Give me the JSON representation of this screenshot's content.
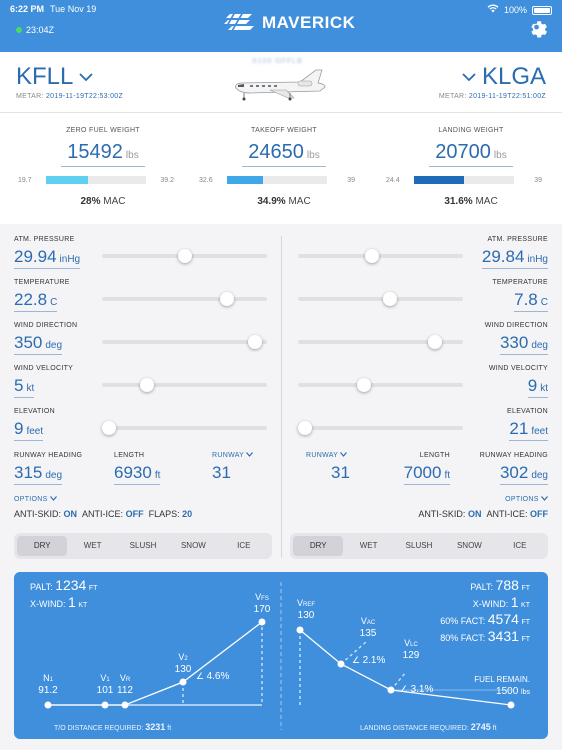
{
  "status": {
    "time": "6:22 PM",
    "day": "Tue Nov 19",
    "battery": "100%",
    "zulu": "23:04Z"
  },
  "brand": {
    "name": "MAVERICK"
  },
  "departure": {
    "code": "KFLL",
    "metar_label": "METAR:",
    "metar_time": "2019-11-19T22:53:00Z"
  },
  "arrival": {
    "code": "KLGA",
    "metar_label": "METAR:",
    "metar_time": "2019-11-19T22:51:00Z"
  },
  "aircraft": {
    "tail": "S100 OFFLB"
  },
  "weights": [
    {
      "title": "ZERO FUEL WEIGHT",
      "value": "15492",
      "unit": "lbs",
      "mac_min": "19.7",
      "mac_max": "39.2",
      "mac_pct": "28%",
      "mac_label": "MAC",
      "fill": 0.42,
      "color": "#5fd0ef"
    },
    {
      "title": "TAKEOFF WEIGHT",
      "value": "24650",
      "unit": "lbs",
      "mac_min": "32.6",
      "mac_max": "39",
      "mac_pct": "34.9%",
      "mac_label": "MAC",
      "fill": 0.36,
      "color": "#3fa9e8"
    },
    {
      "title": "LANDING WEIGHT",
      "value": "20700",
      "unit": "lbs",
      "mac_min": "24.4",
      "mac_max": "39",
      "mac_pct": "31.6%",
      "mac_label": "MAC",
      "fill": 0.5,
      "color": "#1e6bb8"
    }
  ],
  "left_params": [
    {
      "label": "ATM. PRESSURE",
      "value": "29.94",
      "unit": "inHg",
      "level": 0.5
    },
    {
      "label": "TEMPERATURE",
      "value": "22.8",
      "unit": "C",
      "level": 0.76
    },
    {
      "label": "WIND DIRECTION",
      "value": "350",
      "unit": "deg",
      "level": 0.93
    },
    {
      "label": "WIND VELOCITY",
      "value": "5",
      "unit": "kt",
      "level": 0.27
    },
    {
      "label": "ELEVATION",
      "value": "9",
      "unit": "feet",
      "level": 0.04
    }
  ],
  "right_params": [
    {
      "label": "ATM. PRESSURE",
      "value": "29.84",
      "unit": "inHg",
      "level": 0.45
    },
    {
      "label": "TEMPERATURE",
      "value": "7.8",
      "unit": "C",
      "level": 0.56
    },
    {
      "label": "WIND DIRECTION",
      "value": "330",
      "unit": "deg",
      "level": 0.83
    },
    {
      "label": "WIND VELOCITY",
      "value": "9",
      "unit": "kt",
      "level": 0.4
    },
    {
      "label": "ELEVATION",
      "value": "21",
      "unit": "feet",
      "level": 0.04
    }
  ],
  "left_runway": {
    "heading_label": "RUNWAY HEADING",
    "heading": "315",
    "heading_unit": "deg",
    "length_label": "LENGTH",
    "length": "6930",
    "length_unit": "ft",
    "runway_label": "RUNWAY",
    "runway": "31",
    "options_label": "OPTIONS",
    "antiskid_label": "ANTI-SKID:",
    "antiskid": "ON",
    "antiice_label": "ANTI-ICE:",
    "antiice": "OFF",
    "flaps_label": "FLAPS:",
    "flaps": "20"
  },
  "right_runway": {
    "runway_label": "RUNWAY",
    "runway": "31",
    "length_label": "LENGTH",
    "length": "7000",
    "length_unit": "ft",
    "heading_label": "RUNWAY HEADING",
    "heading": "302",
    "heading_unit": "deg",
    "options_label": "OPTIONS",
    "antiskid_label": "ANTI-SKID:",
    "antiskid": "ON",
    "antiice_label": "ANTI-ICE:",
    "antiice": "OFF"
  },
  "surface_options": [
    "DRY",
    "WET",
    "SLUSH",
    "SNOW",
    "ICE"
  ],
  "surface_selected_left": "DRY",
  "surface_selected_right": "DRY",
  "takeoff": {
    "palt_label": "PALT:",
    "palt": "1234",
    "palt_unit": "FT",
    "xwind_label": "X-WIND:",
    "xwind": "1",
    "xwind_unit": "KT",
    "speeds": [
      {
        "name": "N",
        "sub": "1",
        "value": "91.2"
      },
      {
        "name": "V",
        "sub": "1",
        "value": "101"
      },
      {
        "name": "V",
        "sub": "R",
        "value": "112"
      },
      {
        "name": "V",
        "sub": "2",
        "value": "130"
      },
      {
        "name": "V",
        "sub": "FS",
        "value": "170"
      }
    ],
    "gradient": "4.6%",
    "distance_label": "T/O DISTANCE REQUIRED:",
    "distance": "3231",
    "distance_unit": "ft"
  },
  "landing": {
    "palt_label": "PALT:",
    "palt": "788",
    "palt_unit": "FT",
    "xwind_label": "X-WIND:",
    "xwind": "1",
    "xwind_unit": "KT",
    "fact60_label": "60% FACT:",
    "fact60": "4574",
    "fact60_unit": "FT",
    "fact80_label": "80% FACT:",
    "fact80": "3431",
    "fact80_unit": "FT",
    "speeds": [
      {
        "name": "V",
        "sub": "REF",
        "value": "130"
      },
      {
        "name": "V",
        "sub": "AC",
        "value": "135"
      },
      {
        "name": "V",
        "sub": "LC",
        "value": "129"
      }
    ],
    "gradient_ac": "2.1%",
    "gradient_lc": "3.1%",
    "fuel_label": "FUEL REMAIN.",
    "fuel": "1500",
    "fuel_unit": "lbs",
    "distance_label": "LANDING DISTANCE REQUIRED:",
    "distance": "2745",
    "distance_unit": "ft"
  }
}
